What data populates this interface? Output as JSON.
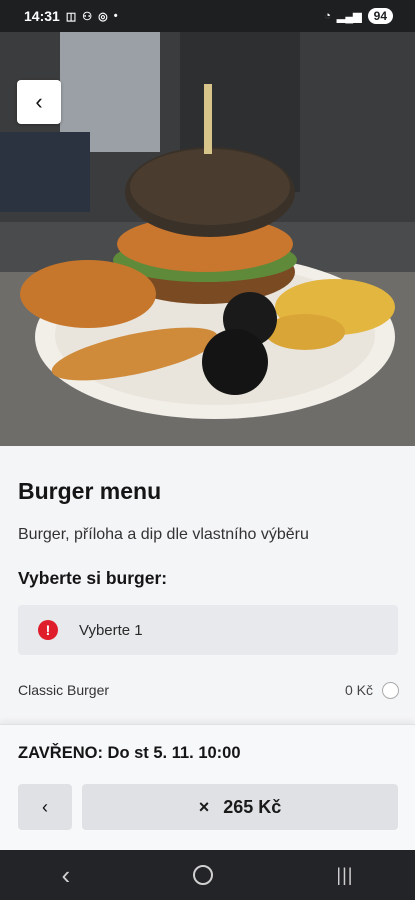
{
  "status": {
    "time": "14:31",
    "battery": "94"
  },
  "product": {
    "title": "Burger menu",
    "description": "Burger, příloha a dip dle vlastního výběru"
  },
  "choice": {
    "section_title": "Vyberte si burger:",
    "selection_prompt": "Vyberte 1",
    "options": [
      {
        "name": "Classic Burger",
        "price": "0 Kč"
      }
    ]
  },
  "footer": {
    "closed_notice": "ZAVŘENO: Do st 5. 11. 10:00",
    "prev_label": "‹",
    "cart_icon": "×",
    "cart_total": "265 Kč"
  }
}
